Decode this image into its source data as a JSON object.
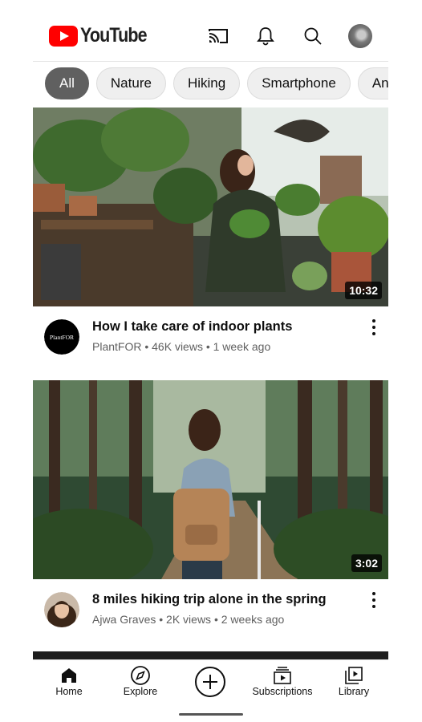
{
  "header": {
    "logo_text": "YouTube",
    "icons": [
      "cast-icon",
      "bell-icon",
      "search-icon",
      "account-avatar"
    ]
  },
  "chips": [
    "All",
    "Nature",
    "Hiking",
    "Smartphone",
    "Anim"
  ],
  "videos": [
    {
      "title": "How I take care of indoor plants",
      "channel": "PlantFOR",
      "channel_avatar_text": "PlantFOR",
      "stats": "PlantFOR • 46K views • 1 week ago",
      "duration": "10:32"
    },
    {
      "title": "8 miles hiking trip alone in the spring",
      "channel": "Ajwa Graves",
      "stats": "Ajwa Graves  • 2K views • 2 weeks ago",
      "duration": "3:02"
    }
  ],
  "nav": {
    "home": "Home",
    "explore": "Explore",
    "subscriptions": "Subscriptions",
    "library": "Library"
  },
  "colors": {
    "brand_red": "#ff0000",
    "active_chip": "#606060",
    "secondary_text": "#606060"
  }
}
